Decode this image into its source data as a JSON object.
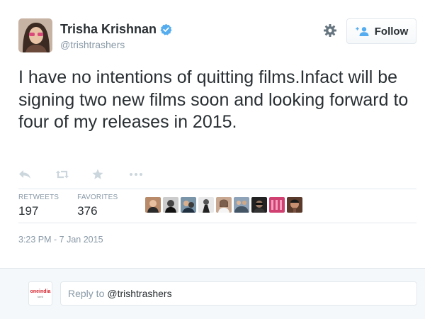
{
  "user": {
    "name": "Trisha Krishnan",
    "handle": "@trishtrashers"
  },
  "header": {
    "follow_label": "Follow"
  },
  "tweet": {
    "text": "I have no intentions of quitting films.Infact will be signing two new films soon and looking forward to four of my releases in 2015.",
    "timestamp": "3:23 PM - 7 Jan 2015"
  },
  "stats": {
    "retweets_label": "RETWEETS",
    "retweets_value": "197",
    "favorites_label": "FAVORITES",
    "favorites_value": "376"
  },
  "actions": [
    "reply-icon",
    "retweet-icon",
    "favorite-icon",
    "more-icon"
  ],
  "reply": {
    "prefix": "Reply to",
    "mention": "@trishtrashers"
  },
  "reply_avatar": {
    "logo_main": "oneindia",
    "logo_sub": "tamil"
  },
  "colors": {
    "accent": "#55acee",
    "text": "#292f33",
    "muted": "#8899a6",
    "border": "#e1e8ed"
  }
}
